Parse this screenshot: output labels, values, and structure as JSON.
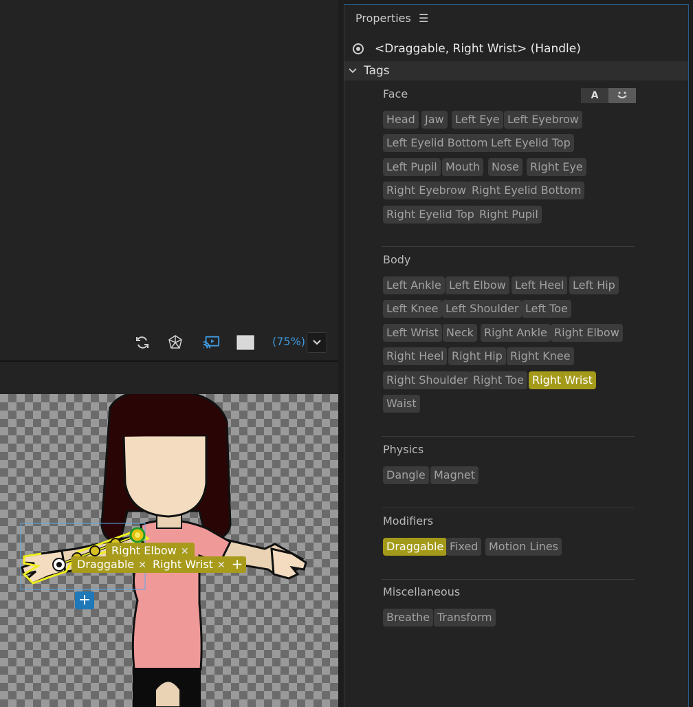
{
  "viewer": {
    "zoom": "(75%)",
    "icons": [
      "refresh-icon",
      "cube-icon",
      "cast-icon",
      "background-swatch-icon",
      "chevron-down-icon"
    ],
    "overlay_tags": {
      "elbow": "Right Elbow",
      "draggable": "Draggable",
      "wrist": "Right Wrist",
      "remove": "✕",
      "add": "+"
    }
  },
  "panel": {
    "title": "Properties",
    "menu": "☰",
    "selection": "<Draggable, Right Wrist> (Handle)",
    "tags_header": "Tags",
    "face_toggle": {
      "a": "A",
      "face": "◡"
    },
    "sections": {
      "face": {
        "title": "Face",
        "chips": [
          "Head",
          "Jaw",
          "Left Eye",
          "Left Eyebrow",
          "Left Eyelid Bottom",
          "Left Eyelid Top",
          "Left Pupil",
          "Mouth",
          "Nose",
          "Right Eye",
          "Right Eyebrow",
          "Right Eyelid Bottom",
          "Right Eyelid Top",
          "Right Pupil"
        ]
      },
      "body": {
        "title": "Body",
        "chips": [
          "Left Ankle",
          "Left Elbow",
          "Left Heel",
          "Left Hip",
          "Left Knee",
          "Left Shoulder",
          "Left Toe",
          "Left Wrist",
          "Neck",
          "Right Ankle",
          "Right Elbow",
          "Right Heel",
          "Right Hip",
          "Right Knee",
          "Right Shoulder",
          "Right Toe",
          "Right Wrist",
          "Waist"
        ],
        "active": "Right Wrist"
      },
      "physics": {
        "title": "Physics",
        "chips": [
          "Dangle",
          "Magnet"
        ]
      },
      "modifiers": {
        "title": "Modifiers",
        "chips": [
          "Draggable",
          "Fixed",
          "Motion Lines"
        ],
        "active": "Draggable"
      },
      "misc": {
        "title": "Miscellaneous",
        "chips": [
          "Breathe",
          "Transform"
        ]
      }
    }
  },
  "colors": {
    "accent_blue": "#3f9ae0",
    "tag_active": "#a49a1a",
    "chip_bg": "#3b3b3b"
  }
}
